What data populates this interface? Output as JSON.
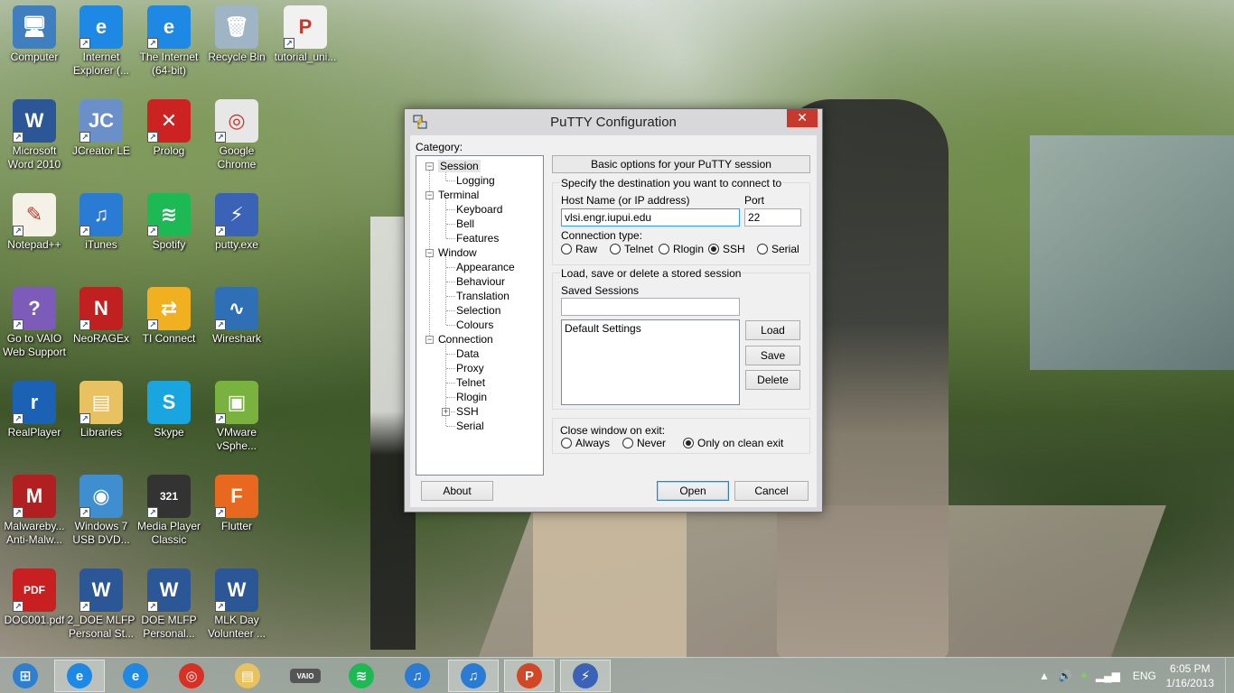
{
  "desktop": {
    "icons": [
      {
        "label": "Computer",
        "color": "#3f7fc0",
        "glyph": "🖥"
      },
      {
        "label": "Internet Explorer (...",
        "color": "#1e88e5",
        "glyph": "e"
      },
      {
        "label": "The Internet (64-bit)",
        "color": "#1e88e5",
        "glyph": "e"
      },
      {
        "label": "Recycle Bin",
        "color": "#9fb4c4",
        "glyph": "🗑"
      },
      {
        "label": "tutorial_uni...",
        "color": "#f1f1f1",
        "glyph": "P"
      },
      {
        "label": "Microsoft Word 2010",
        "color": "#2b5797",
        "glyph": "W"
      },
      {
        "label": "JCreator LE",
        "color": "#6b8fc8",
        "glyph": "JC"
      },
      {
        "label": "Prolog",
        "color": "#cc2222",
        "glyph": "✕"
      },
      {
        "label": "Google Chrome",
        "color": "#e7e7e7",
        "glyph": "◎"
      },
      {
        "label": "Notepad++",
        "color": "#f4f1e6",
        "glyph": "✎"
      },
      {
        "label": "iTunes",
        "color": "#2a7bd3",
        "glyph": "♫"
      },
      {
        "label": "Spotify",
        "color": "#1db954",
        "glyph": "≋"
      },
      {
        "label": "putty.exe",
        "color": "#3a63b8",
        "glyph": "⚡"
      },
      {
        "label": "Go to VAIO Web Support",
        "color": "#7c5cb8",
        "glyph": "?"
      },
      {
        "label": "NeoRAGEx",
        "color": "#c02020",
        "glyph": "N"
      },
      {
        "label": "TI Connect",
        "color": "#f0b020",
        "glyph": "⇄"
      },
      {
        "label": "Wireshark",
        "color": "#2f6fb5",
        "glyph": "∿"
      },
      {
        "label": "RealPlayer",
        "color": "#1b62b5",
        "glyph": "r"
      },
      {
        "label": "Libraries",
        "color": "#e8c160",
        "glyph": "▤"
      },
      {
        "label": "Skype",
        "color": "#18a5e0",
        "glyph": "S"
      },
      {
        "label": "VMware vSphe...",
        "color": "#7ab23f",
        "glyph": "▣"
      },
      {
        "label": "Malwareby... Anti-Malw...",
        "color": "#b02020",
        "glyph": "M"
      },
      {
        "label": "Windows 7 USB DVD...",
        "color": "#3f8fd0",
        "glyph": "◉"
      },
      {
        "label": "Media Player Classic",
        "color": "#333333",
        "glyph": "321"
      },
      {
        "label": "Flutter",
        "color": "#e86820",
        "glyph": "F"
      },
      {
        "label": "DOC001.pdf",
        "color": "#c82020",
        "glyph": "PDF"
      },
      {
        "label": "2_DOE MLFP Personal St...",
        "color": "#2b5797",
        "glyph": "W"
      },
      {
        "label": "DOE MLFP Personal...",
        "color": "#2b5797",
        "glyph": "W"
      },
      {
        "label": "MLK Day Volunteer ...",
        "color": "#2b5797",
        "glyph": "W"
      }
    ]
  },
  "putty": {
    "title": "PuTTY Configuration",
    "close": "✕",
    "category_label": "Category:",
    "tree": [
      {
        "label": "Session",
        "level": 0,
        "expanded": true,
        "selected": true
      },
      {
        "label": "Logging",
        "level": 1
      },
      {
        "label": "Terminal",
        "level": 0,
        "expanded": true
      },
      {
        "label": "Keyboard",
        "level": 1
      },
      {
        "label": "Bell",
        "level": 1
      },
      {
        "label": "Features",
        "level": 1
      },
      {
        "label": "Window",
        "level": 0,
        "expanded": true
      },
      {
        "label": "Appearance",
        "level": 1
      },
      {
        "label": "Behaviour",
        "level": 1
      },
      {
        "label": "Translation",
        "level": 1
      },
      {
        "label": "Selection",
        "level": 1
      },
      {
        "label": "Colours",
        "level": 1
      },
      {
        "label": "Connection",
        "level": 0,
        "expanded": true
      },
      {
        "label": "Data",
        "level": 1
      },
      {
        "label": "Proxy",
        "level": 1
      },
      {
        "label": "Telnet",
        "level": 1
      },
      {
        "label": "Rlogin",
        "level": 1
      },
      {
        "label": "SSH",
        "level": 1,
        "collapsed": true
      },
      {
        "label": "Serial",
        "level": 1
      }
    ],
    "panel_header": "Basic options for your PuTTY session",
    "dest_group": "Specify the destination you want to connect to",
    "host_label": "Host Name (or IP address)",
    "host_value": "vlsi.engr.iupui.edu",
    "port_label": "Port",
    "port_value": "22",
    "conn_type_label": "Connection type:",
    "conn_types": [
      {
        "label": "Raw",
        "checked": false
      },
      {
        "label": "Telnet",
        "checked": false
      },
      {
        "label": "Rlogin",
        "checked": false
      },
      {
        "label": "SSH",
        "checked": true
      },
      {
        "label": "Serial",
        "checked": false
      }
    ],
    "sessions_group": "Load, save or delete a stored session",
    "saved_sessions_label": "Saved Sessions",
    "saved_sessions_value": "",
    "sessions_list": [
      "Default Settings"
    ],
    "load": "Load",
    "save": "Save",
    "delete": "Delete",
    "close_on_exit_label": "Close window on exit:",
    "close_options": [
      {
        "label": "Always",
        "checked": false
      },
      {
        "label": "Never",
        "checked": false
      },
      {
        "label": "Only on clean exit",
        "checked": true
      }
    ],
    "about": "About",
    "open": "Open",
    "cancel": "Cancel"
  },
  "taskbar": {
    "apps": [
      {
        "name": "start-button",
        "color": "#2f7fd0",
        "glyph": "⊞",
        "active": false
      },
      {
        "name": "taskbar-ie-pinned",
        "color": "#1e88e5",
        "glyph": "e",
        "active": true
      },
      {
        "name": "taskbar-ie",
        "color": "#1e88e5",
        "glyph": "e",
        "active": false
      },
      {
        "name": "taskbar-chrome",
        "color": "#d93025",
        "glyph": "◎",
        "active": false
      },
      {
        "name": "taskbar-explorer",
        "color": "#e8c160",
        "glyph": "▤",
        "active": false
      },
      {
        "name": "taskbar-vaio",
        "color": "#555555",
        "glyph": "VAIO",
        "active": false
      },
      {
        "name": "taskbar-spotify",
        "color": "#1db954",
        "glyph": "≋",
        "active": false
      },
      {
        "name": "taskbar-itunes",
        "color": "#2a7bd3",
        "glyph": "♫",
        "active": false
      },
      {
        "name": "taskbar-itunes-2",
        "color": "#2a7bd3",
        "glyph": "♫",
        "active": true
      },
      {
        "name": "taskbar-powerpoint",
        "color": "#d24726",
        "glyph": "P",
        "active": true
      },
      {
        "name": "taskbar-putty",
        "color": "#3a63b8",
        "glyph": "⚡",
        "active": true
      }
    ],
    "language": "ENG",
    "time": "6:05 PM",
    "date": "1/16/2013"
  }
}
